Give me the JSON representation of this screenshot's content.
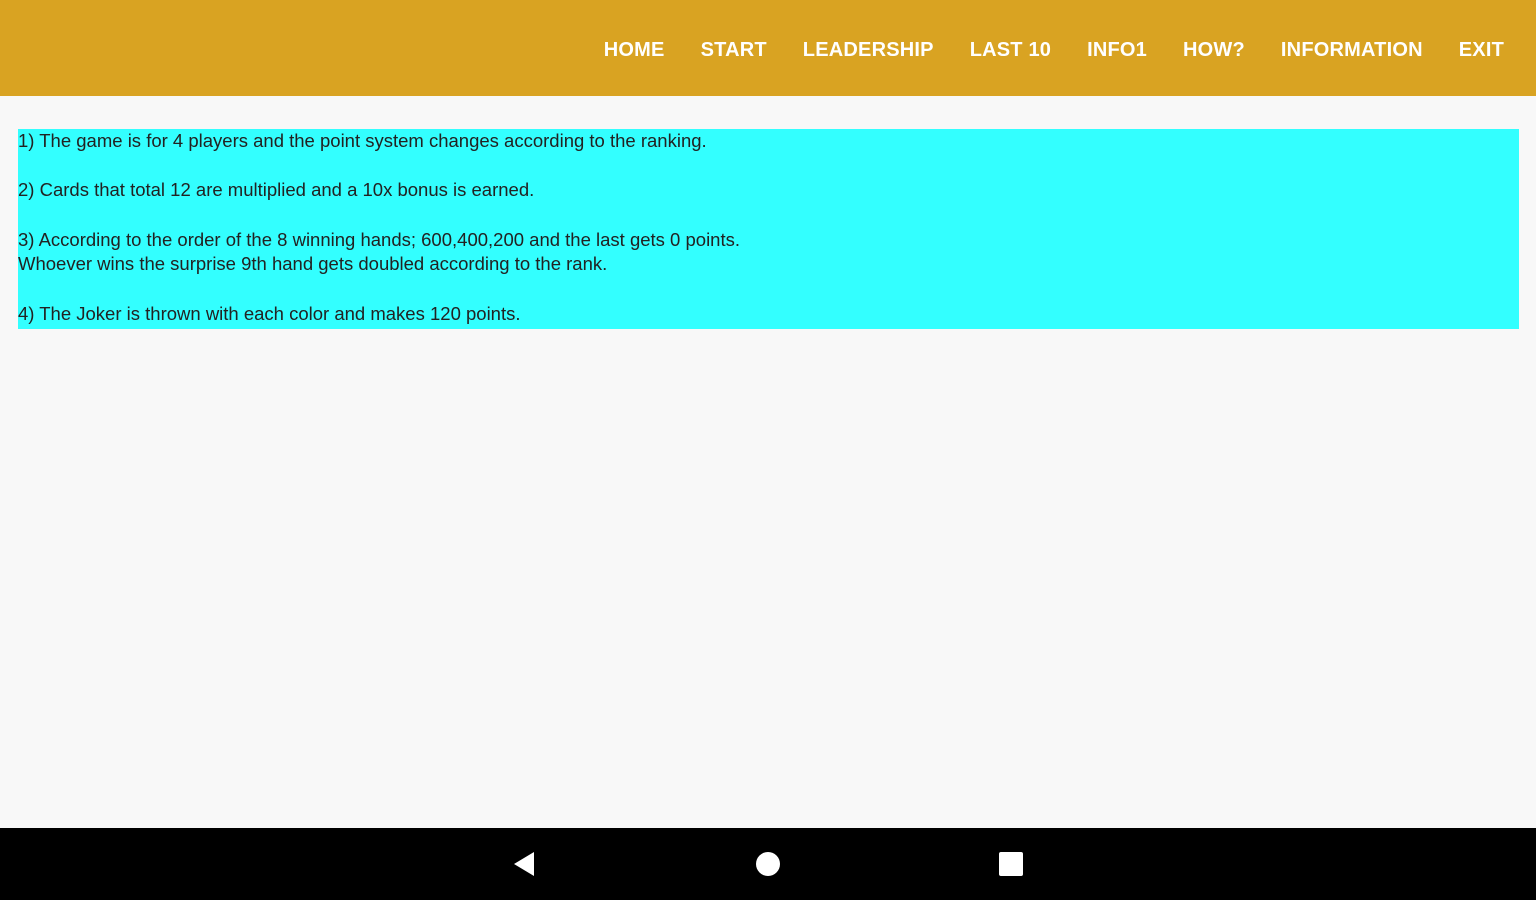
{
  "header": {
    "background_color": "#d9a322",
    "menu": [
      {
        "label": "HOME"
      },
      {
        "label": "START"
      },
      {
        "label": "LEADERSHIP"
      },
      {
        "label": "LAST 10"
      },
      {
        "label": "INFO1"
      },
      {
        "label": "HOW?"
      },
      {
        "label": "INFORMATION"
      },
      {
        "label": "EXIT"
      }
    ]
  },
  "rules": {
    "background_color": "#33ffff",
    "lines": [
      "1) The game is for 4 players and the point system changes according to the ranking.",
      "",
      "2) Cards that total 12 are multiplied and a 10x bonus is earned.",
      "",
      "3) According to the order of the 8 winning hands; 600,400,200 and the last gets 0 points.",
      "Whoever wins the surprise 9th hand gets doubled according to the rank.",
      "",
      "4) The Joker is thrown with each color and makes 120 points."
    ]
  },
  "navigation_bar": {
    "buttons": [
      {
        "icon": "back-triangle-icon"
      },
      {
        "icon": "home-circle-icon"
      },
      {
        "icon": "recents-square-icon"
      }
    ]
  }
}
